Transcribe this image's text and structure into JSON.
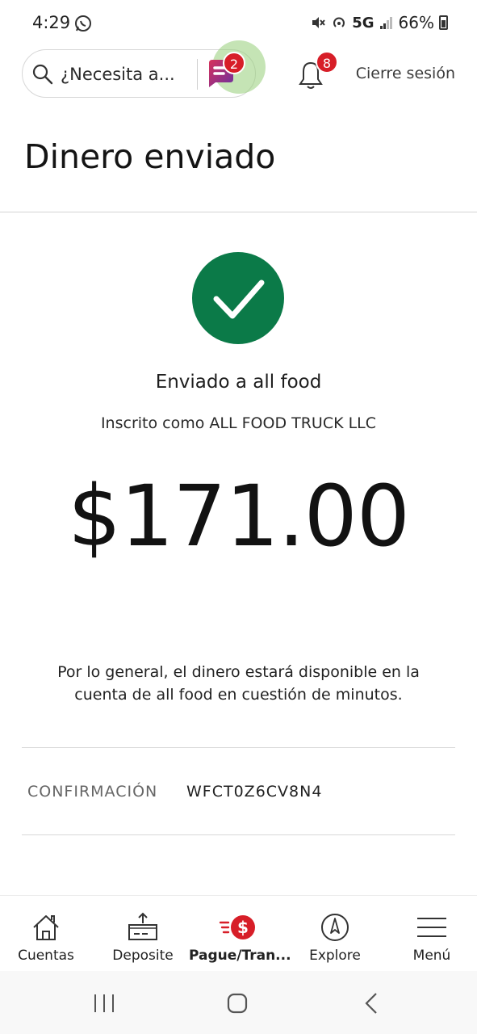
{
  "status_bar": {
    "time": "4:29",
    "network": "5G",
    "battery": "66%"
  },
  "header": {
    "search_placeholder": "¿Necesita a...",
    "fargo_badge": "2",
    "notifications_badge": "8",
    "signout_label": "Cierre sesión"
  },
  "page": {
    "title": "Dinero enviado"
  },
  "confirmation": {
    "sent_to": "Enviado a all food",
    "enrolled_as": "Inscrito como ALL FOOD TRUCK LLC",
    "amount": "$171.00",
    "availability_note": "Por lo general, el dinero estará disponible en la cuenta de all food en cuestión de minutos.",
    "label": "CONFIRMACIÓN",
    "code": "WFCT0Z6CV8N4"
  },
  "bottom_nav": {
    "items": [
      {
        "label": "Cuentas",
        "icon": "house-icon"
      },
      {
        "label": "Deposite",
        "icon": "deposit-icon"
      },
      {
        "label": "Pague/Tran...",
        "icon": "pay-transfer-icon"
      },
      {
        "label": "Explore",
        "icon": "compass-icon"
      },
      {
        "label": "Menú",
        "icon": "hamburger-menu-icon"
      }
    ]
  },
  "colors": {
    "success_green": "#0b7a48",
    "brand_red": "#d71e28"
  }
}
